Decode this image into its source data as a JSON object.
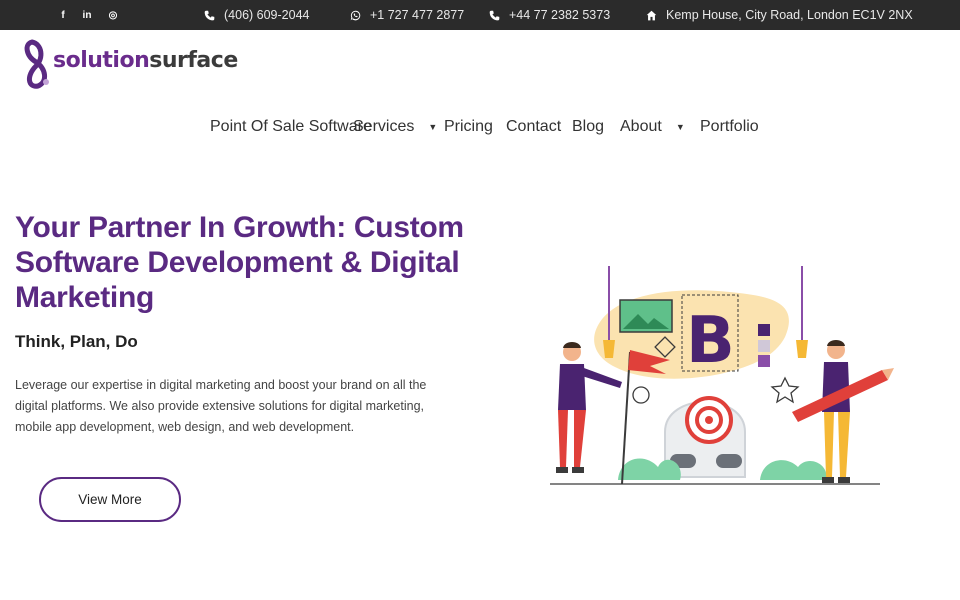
{
  "topbar": {
    "social": [
      {
        "icon": "facebook-icon",
        "glyph": "f"
      },
      {
        "icon": "linkedin-icon",
        "glyph": "in"
      },
      {
        "icon": "instagram-icon",
        "glyph": "◎"
      }
    ],
    "phone_1": "(406) 609-2044",
    "whatsapp": "+1 727 477 2877",
    "phone_2": "+44 77 2382 5373",
    "address": "Kemp House, City Road, London EC1V 2NX"
  },
  "logo": {
    "part1": "solution",
    "part2": "surface"
  },
  "nav": {
    "items": [
      {
        "label": "Point Of Sale Software"
      },
      {
        "label": "Services",
        "dropdown": true
      },
      {
        "label": "Pricing"
      },
      {
        "label": "Contact"
      },
      {
        "label": "Blog"
      },
      {
        "label": "About",
        "dropdown": true
      },
      {
        "label": "Portfolio"
      }
    ],
    "caret": "▼"
  },
  "hero": {
    "title": "Your Partner In Growth: Custom Software Development & Digital Marketing",
    "subtitle": "Think, Plan, Do",
    "description": "Leverage our expertise in digital marketing and boost your brand on all the digital platforms. We also provide extensive solutions for digital marketing, mobile app development, web design, and web development.",
    "cta_label": "View More",
    "illustration_letter": "B"
  },
  "colors": {
    "brand_purple": "#5a2a82",
    "topbar_bg": "#2b2b2b",
    "accent_red": "#e0403a",
    "accent_yellow": "#f5b835"
  }
}
